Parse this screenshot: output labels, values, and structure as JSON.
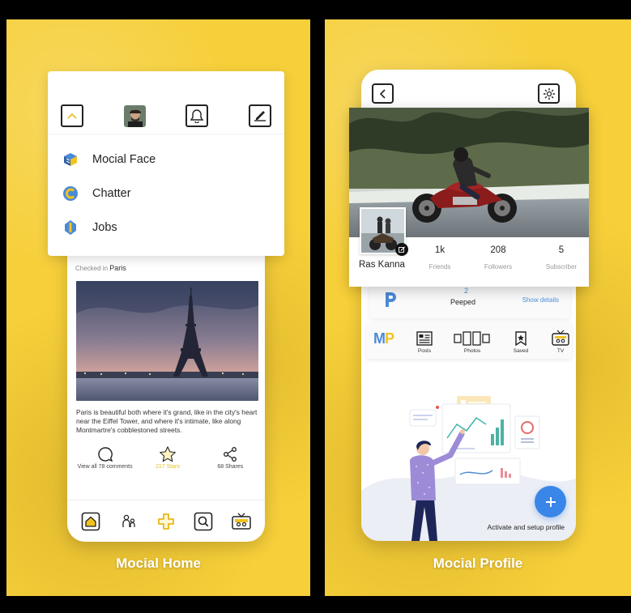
{
  "screens": {
    "home": {
      "caption": "Mocial Home",
      "menu": {
        "items": [
          {
            "label": "Mocial Face",
            "icon": "mocial-face-logo-icon"
          },
          {
            "label": "Chatter",
            "icon": "chatter-logo-icon"
          },
          {
            "label": "Jobs",
            "icon": "jobs-logo-icon"
          }
        ]
      },
      "post": {
        "checked_in_prefix": "Checked in",
        "location": "Paris",
        "text": "Paris is beautiful both where it's grand, like in the city's heart near the Eiffel Tower, and where it's intimate, like along Montmartre's cobblestoned streets.",
        "comments_label": "View all 78 comments",
        "stars_label": "217 Stars",
        "shares_label": "68 Shares"
      }
    },
    "profile": {
      "caption": "Mocial Profile",
      "name": "Ras Kanna",
      "stats": [
        {
          "value": "1k",
          "label": "Friends"
        },
        {
          "value": "208",
          "label": "Followers"
        },
        {
          "value": "5",
          "label": "Subscriber"
        }
      ],
      "peeped": {
        "count": "2",
        "label": "Peeped",
        "link": "Show details"
      },
      "tabs": [
        {
          "label": "Posts",
          "icon": "posts-icon"
        },
        {
          "label": "Photos",
          "icon": "photos-icon"
        },
        {
          "label": "Saved",
          "icon": "saved-icon"
        },
        {
          "label": "TV",
          "icon": "tv-icon"
        }
      ],
      "activate_label": "Activate and setup profile"
    }
  },
  "colors": {
    "accent_yellow": "#f6cf3a",
    "brand_blue": "#3a86e8"
  }
}
